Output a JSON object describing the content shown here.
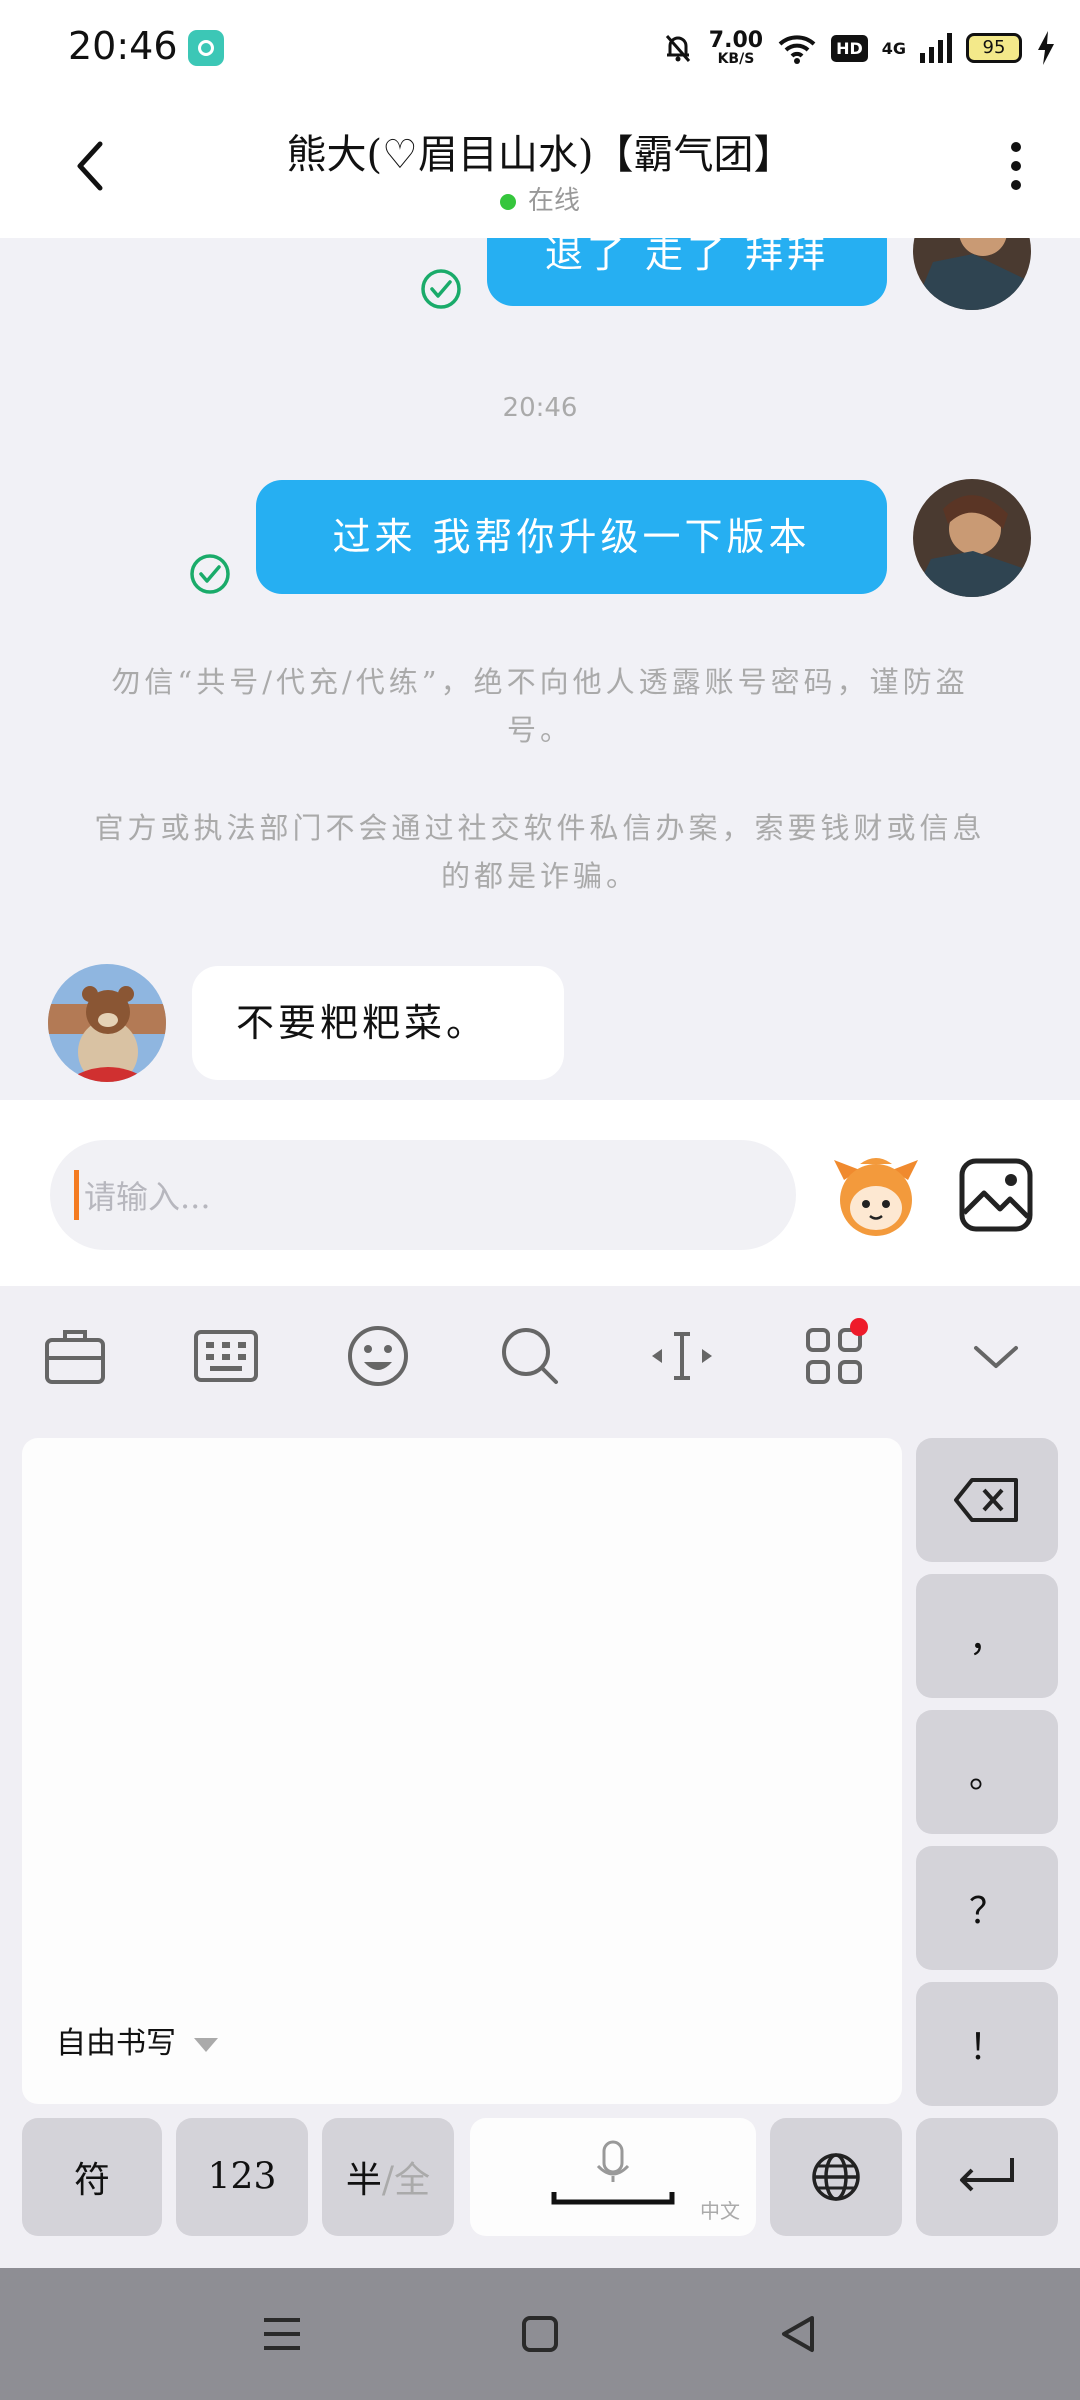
{
  "status_bar": {
    "time": "20:46",
    "net_speed_value": "7.00",
    "net_speed_unit": "KB/S",
    "hd": "HD",
    "network": "4G",
    "battery": "95"
  },
  "header": {
    "title": "熊大(♡眉目山水)【霸气团】",
    "status": "在线"
  },
  "chat": {
    "messages": [
      {
        "direction": "out",
        "text": "退了 走了 拜拜",
        "read": true
      },
      {
        "direction": "out",
        "text": "过来 我帮你升级一下版本",
        "read": true
      },
      {
        "direction": "in",
        "text": "不要粑粑菜。"
      }
    ],
    "timestamp": "20:46",
    "notices": [
      "勿信“共号/代充/代练”，绝不向他人透露账号密码，谨防盗号。",
      "官方或执法部门不会通过社交软件私信办案，索要钱财或信息的都是诈骗。"
    ]
  },
  "input": {
    "placeholder": "请输入..."
  },
  "keyboard": {
    "toolbar": [
      "clipboard-icon",
      "keyboard-icon",
      "emoji-icon",
      "search-icon",
      "cursor-icon",
      "apps-icon",
      "collapse-icon"
    ],
    "handwriting_mode": "自由书写",
    "side_keys": [
      "，",
      "。",
      "？",
      "！"
    ],
    "bottom_keys": {
      "symbols": "符",
      "numbers": "123",
      "half_label": "半",
      "full_label": "全",
      "space_sub": "中文"
    }
  },
  "colors": {
    "bubble_out": "#26aff2",
    "online": "#35c63c",
    "read_check": "#1aab6a",
    "badge": "#ee1b2a",
    "caret": "#f47b20"
  }
}
